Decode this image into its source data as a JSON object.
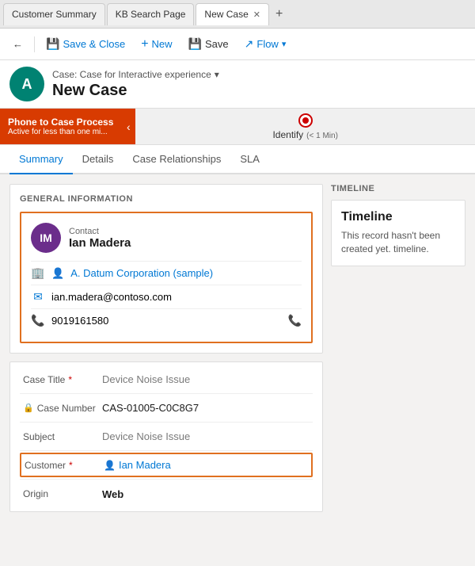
{
  "browser": {
    "tabs": [
      {
        "id": "customer-summary",
        "label": "Customer Summary",
        "active": false
      },
      {
        "id": "kb-search-page",
        "label": "KB Search Page",
        "active": false
      },
      {
        "id": "new-case",
        "label": "New Case",
        "active": true
      }
    ],
    "add_tab_label": "+"
  },
  "toolbar": {
    "save_close_label": "Save & Close",
    "new_label": "New",
    "save_label": "Save",
    "flow_label": "Flow",
    "back_icon": "←",
    "save_icon": "💾",
    "flow_icon": "↗",
    "dropdown_icon": "▾"
  },
  "record_header": {
    "avatar_initials": "A",
    "breadcrumb": "Case: Case for Interactive experience",
    "breadcrumb_chevron": "▾",
    "title": "New Case"
  },
  "bpf": {
    "active_label": "Phone to Case Process",
    "active_sub": "Active for less than one mi...",
    "collapse_icon": "‹",
    "step_label": "Identify",
    "step_time": "(< 1 Min)"
  },
  "nav_tabs": [
    {
      "id": "summary",
      "label": "Summary",
      "active": true
    },
    {
      "id": "details",
      "label": "Details",
      "active": false
    },
    {
      "id": "case-relationships",
      "label": "Case Relationships",
      "active": false
    },
    {
      "id": "sla",
      "label": "SLA",
      "active": false
    }
  ],
  "general_info": {
    "section_title": "GENERAL INFORMATION",
    "contact": {
      "avatar_initials": "IM",
      "label": "Contact",
      "name": "Ian Madera",
      "company_icon": "🏢",
      "company": "A. Datum Corporation (sample)",
      "email_icon": "✉",
      "email": "ian.madera@contoso.com",
      "phone_icon": "📞",
      "phone": "9019161580",
      "call_icon": "📞"
    }
  },
  "form_fields": {
    "case_title_label": "Case Title",
    "case_title_value": "Device Noise Issue",
    "case_number_label": "Case Number",
    "case_number_value": "CAS-01005-C0C8G7",
    "subject_label": "Subject",
    "subject_value": "Device Noise Issue",
    "customer_label": "Customer",
    "customer_value": "Ian Madera",
    "origin_label": "Origin",
    "origin_value": "Web",
    "required_marker": "*",
    "lock_icon": "🔒",
    "contact_icon": "👤"
  },
  "timeline": {
    "section_title": "TIMELINE",
    "title": "Timeline",
    "empty_text": "This record hasn't been created yet. timeline."
  }
}
